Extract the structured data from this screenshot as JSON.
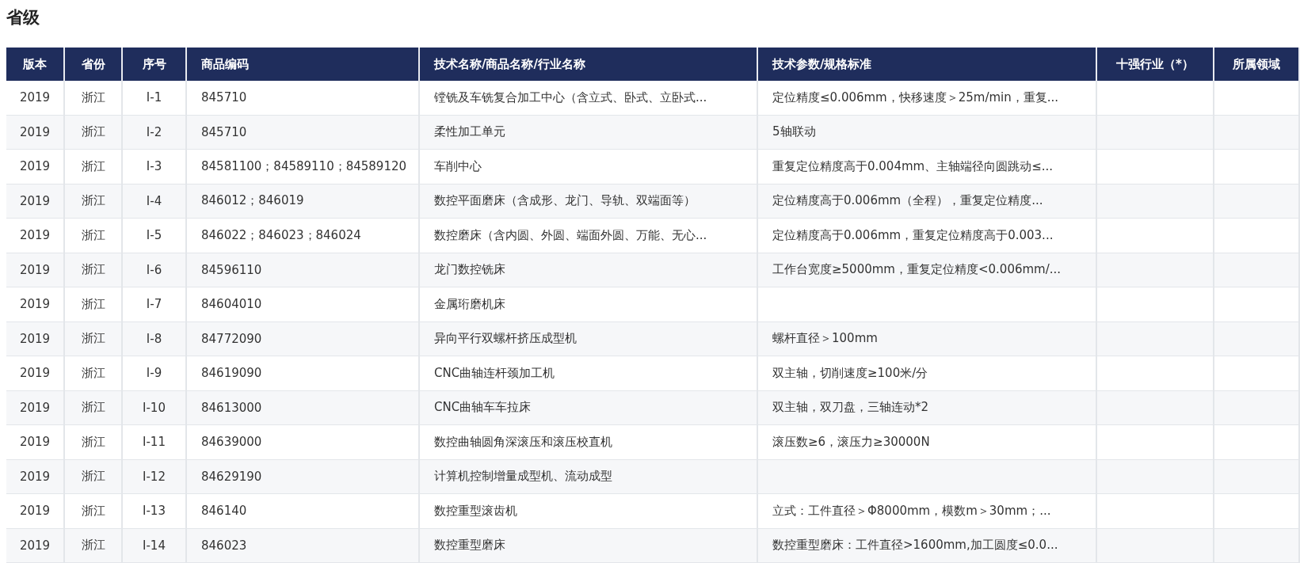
{
  "title": "省级",
  "table": {
    "columns": [
      "版本",
      "省份",
      "序号",
      "商品编码",
      "技术名称/商品名称/行业名称",
      "技术参数/规格标准",
      "十强行业（*）",
      "所属领域"
    ],
    "rows": [
      {
        "version": "2019",
        "province": "浙江",
        "seq": "Ⅰ-1",
        "code": "845710",
        "name": "镗铣及车铣复合加工中心（含立式、卧式、立卧式...",
        "spec": "定位精度≤0.006mm，快移速度＞25m/min，重复..."
      },
      {
        "version": "2019",
        "province": "浙江",
        "seq": "Ⅰ-2",
        "code": "845710",
        "name": "柔性加工单元",
        "spec": "5轴联动"
      },
      {
        "version": "2019",
        "province": "浙江",
        "seq": "Ⅰ-3",
        "code": "84581100；84589110；84589120",
        "name": "车削中心",
        "spec": "重复定位精度高于0.004mm、主轴端径向圆跳动≤..."
      },
      {
        "version": "2019",
        "province": "浙江",
        "seq": "Ⅰ-4",
        "code": "846012；846019",
        "name": "数控平面磨床（含成形、龙门、导轨、双端面等）",
        "spec": "定位精度高于0.006mm（全程），重复定位精度..."
      },
      {
        "version": "2019",
        "province": "浙江",
        "seq": "Ⅰ-5",
        "code": "846022；846023；846024",
        "name": "数控磨床（含内圆、外圆、端面外圆、万能、无心...",
        "spec": "定位精度高于0.006mm，重复定位精度高于0.003..."
      },
      {
        "version": "2019",
        "province": "浙江",
        "seq": "Ⅰ-6",
        "code": "84596110",
        "name": "龙门数控铣床",
        "spec": "工作台宽度≥5000mm，重复定位精度<0.006mm/..."
      },
      {
        "version": "2019",
        "province": "浙江",
        "seq": "Ⅰ-7",
        "code": "84604010",
        "name": "金属珩磨机床"
      },
      {
        "version": "2019",
        "province": "浙江",
        "seq": "Ⅰ-8",
        "code": "84772090",
        "name": "异向平行双螺杆挤压成型机",
        "spec": "螺杆直径＞100mm"
      },
      {
        "version": "2019",
        "province": "浙江",
        "seq": "Ⅰ-9",
        "code": "84619090",
        "name": "CNC曲轴连杆颈加工机",
        "spec": "双主轴，切削速度≥100米/分"
      },
      {
        "version": "2019",
        "province": "浙江",
        "seq": "Ⅰ-10",
        "code": "84613000",
        "name": "CNC曲轴车车拉床",
        "spec": "双主轴，双刀盘，三轴连动*2"
      },
      {
        "version": "2019",
        "province": "浙江",
        "seq": "Ⅰ-11",
        "code": "84639000",
        "name": "数控曲轴圆角深滚压和滚压校直机",
        "spec": "滚压数≥6，滚压力≥30000N"
      },
      {
        "version": "2019",
        "province": "浙江",
        "seq": "Ⅰ-12",
        "code": "84629190",
        "name": "计算机控制增量成型机、流动成型"
      },
      {
        "version": "2019",
        "province": "浙江",
        "seq": "Ⅰ-13",
        "code": "846140",
        "name": "数控重型滚齿机",
        "spec": "立式：工件直径＞Φ8000mm，模数m＞30mm；..."
      },
      {
        "version": "2019",
        "province": "浙江",
        "seq": "Ⅰ-14",
        "code": "846023",
        "name": "数控重型磨床",
        "spec": "数控重型磨床：工件直径>1600mm,加工圆度≤0.0..."
      }
    ]
  }
}
